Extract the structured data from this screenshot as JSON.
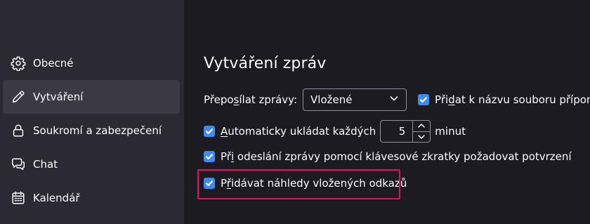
{
  "sidebar": {
    "items": [
      {
        "label": "Obecné",
        "icon": "gear-icon"
      },
      {
        "label": "Vytváření",
        "icon": "pencil-icon",
        "selected": true
      },
      {
        "label": "Soukromí a zabezpečení",
        "icon": "lock-icon"
      },
      {
        "label": "Chat",
        "icon": "chat-icon"
      },
      {
        "label": "Kalendář",
        "icon": "calendar-icon"
      }
    ]
  },
  "composition": {
    "title": "Vytváření zpráv",
    "forward": {
      "label_pre": "Přepo",
      "label_accel": "s",
      "label_post": "ílat zprávy:",
      "value": "Vložené"
    },
    "add_extension": {
      "label_pre": "Při",
      "label_accel": "d",
      "label_post": "at k názvu souboru příponu",
      "checked": true
    },
    "autosave": {
      "label_accel": "A",
      "label_post": "utomaticky ukládat každých",
      "value": "5",
      "unit": "minut",
      "checked": true
    },
    "confirm_send": {
      "label_pre": "Př",
      "label_accel": "i",
      "label_post": " odeslání zprávy pomocí klávesové zkratky požadovat potvrzení",
      "checked": true
    },
    "link_previews": {
      "label_pre": "P",
      "label_accel": "ř",
      "label_post": "idávat náhledy vložených odkazů",
      "checked": true
    }
  },
  "colors": {
    "accent": "#3d8bf0",
    "highlight": "#e0115f",
    "sidebar_bg": "#2b2a33",
    "main_bg": "#1c1b22"
  }
}
